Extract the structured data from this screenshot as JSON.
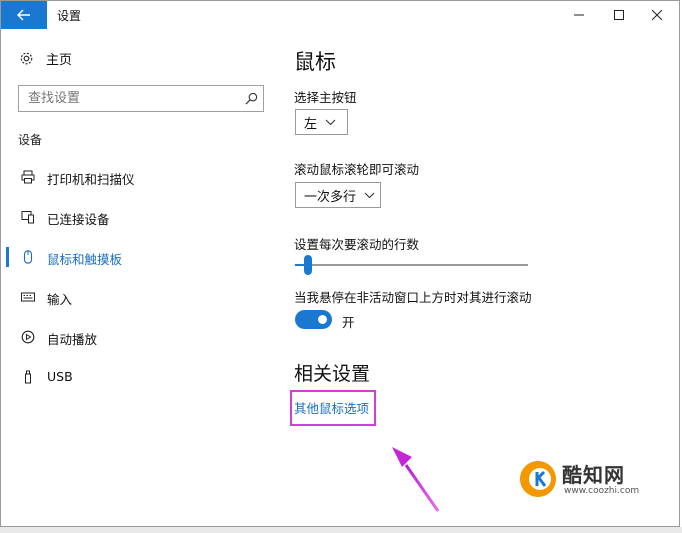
{
  "window": {
    "title": "设置"
  },
  "sidebar": {
    "home_label": "主页",
    "search": {
      "placeholder": "查找设置"
    },
    "section_label": "设备",
    "items": [
      {
        "label": "打印机和扫描仪",
        "icon": "printer-icon"
      },
      {
        "label": "已连接设备",
        "icon": "connected-devices-icon"
      },
      {
        "label": "鼠标和触摸板",
        "icon": "mouse-icon",
        "selected": true
      },
      {
        "label": "输入",
        "icon": "keyboard-icon"
      },
      {
        "label": "自动播放",
        "icon": "autoplay-icon"
      },
      {
        "label": "USB",
        "icon": "usb-icon"
      }
    ]
  },
  "main": {
    "page_title": "鼠标",
    "primary_button": {
      "label": "选择主按钮",
      "value": "左"
    },
    "scroll_wheel": {
      "label": "滚动鼠标滚轮即可滚动",
      "value": "一次多行"
    },
    "lines_to_scroll": {
      "label": "设置每次要滚动的行数",
      "value_fraction": 0.03
    },
    "inactive_scroll": {
      "label": "当我悬停在非活动窗口上方时对其进行滚动",
      "state_label": "开",
      "on": true
    },
    "related_title": "相关设置",
    "related_link": "其他鼠标选项"
  },
  "watermark": {
    "name": "酷知网",
    "url": "www.coozhi.com"
  },
  "colors": {
    "accent": "#1b78d1",
    "highlight_box": "#d23fd4",
    "link": "#1b6fc2"
  }
}
